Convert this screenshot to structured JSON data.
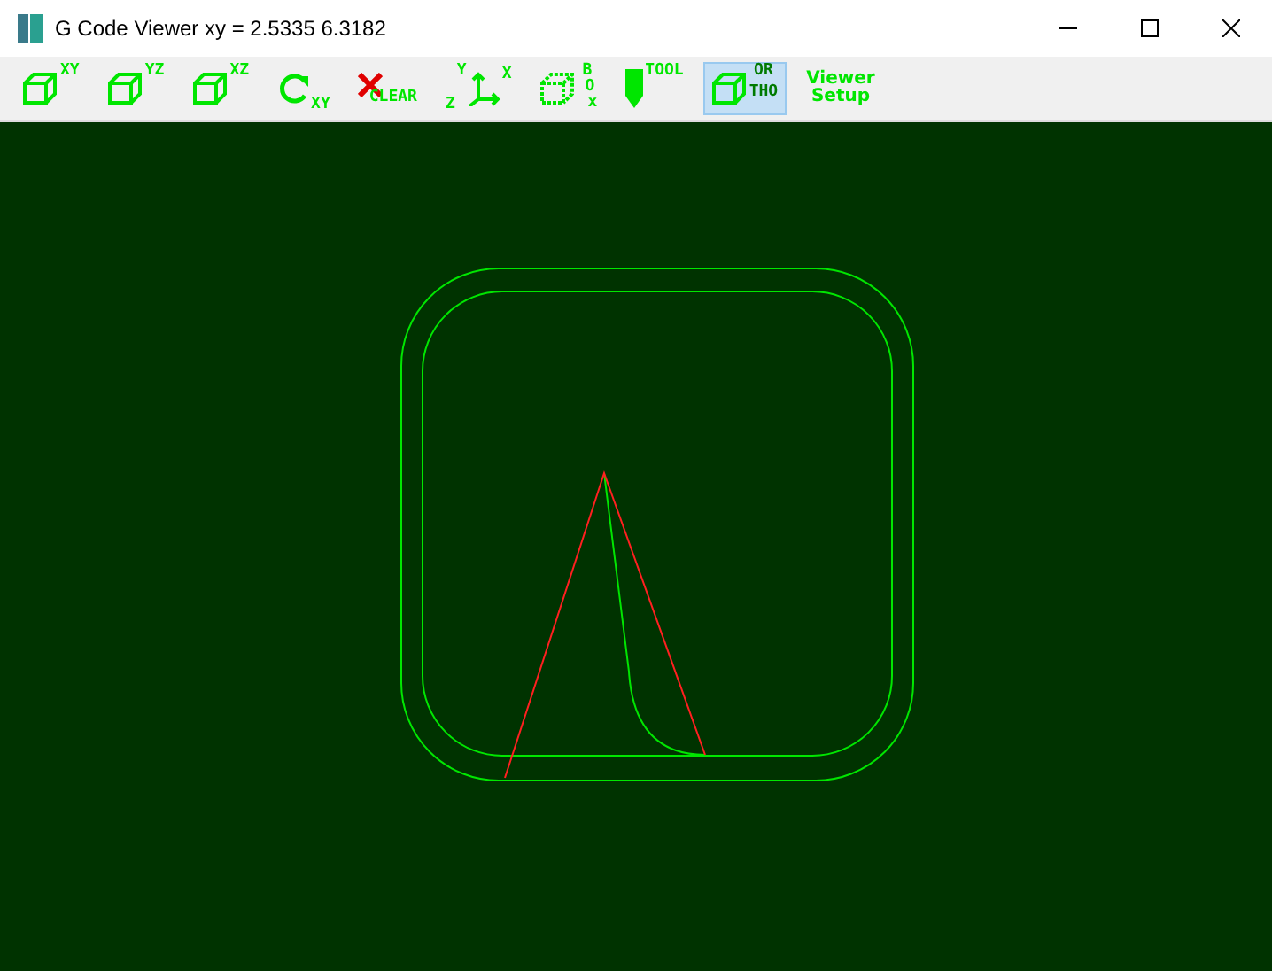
{
  "window": {
    "title": "G Code Viewer  xy = 2.5335 6.3182"
  },
  "toolbar": [
    {
      "kind": "cube",
      "labels": [
        "XY"
      ],
      "selected": false
    },
    {
      "kind": "cube",
      "labels": [
        "YZ"
      ],
      "selected": false
    },
    {
      "kind": "cube",
      "labels": [
        "XZ"
      ],
      "selected": false
    },
    {
      "kind": "rotate",
      "labels": [
        "XY"
      ],
      "selected": false
    },
    {
      "kind": "clear",
      "labels": [
        "CLEAR"
      ],
      "selected": false
    },
    {
      "kind": "axes",
      "labels": [
        "Y",
        "X",
        "Z"
      ],
      "selected": false
    },
    {
      "kind": "box",
      "labels": [
        "B",
        "O",
        "x"
      ],
      "selected": false
    },
    {
      "kind": "tool",
      "labels": [
        "TOOL"
      ],
      "selected": false
    },
    {
      "kind": "ortho",
      "labels": [
        "OR",
        "THO"
      ],
      "selected": true
    },
    {
      "kind": "text",
      "labels": [
        "Viewer",
        "Setup"
      ],
      "selected": false
    }
  ]
}
